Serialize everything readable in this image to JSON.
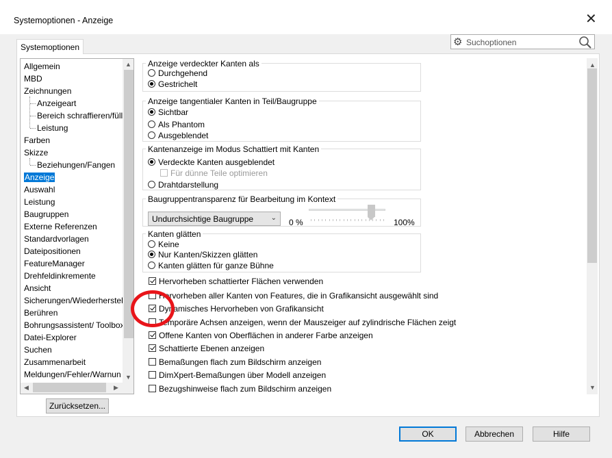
{
  "window": {
    "title": "Systemoptionen - Anzeige",
    "close_glyph": "✕",
    "close_icon": "close-icon"
  },
  "search": {
    "placeholder": "Suchoptionen",
    "gear_icon": "gear-icon",
    "search_icon": "search-icon"
  },
  "tab": {
    "label": "Systemoptionen"
  },
  "tree": {
    "items": [
      {
        "label": "Allgemein",
        "level": 1
      },
      {
        "label": "MBD",
        "level": 1
      },
      {
        "label": "Zeichnungen",
        "level": 1
      },
      {
        "label": "Anzeigeart",
        "level": 2
      },
      {
        "label": "Bereich schraffieren/füll",
        "level": 2
      },
      {
        "label": "Leistung",
        "level": 2
      },
      {
        "label": "Farben",
        "level": 1
      },
      {
        "label": "Skizze",
        "level": 1
      },
      {
        "label": "Beziehungen/Fangen",
        "level": 2
      },
      {
        "label": "Anzeige",
        "level": 1,
        "selected": true
      },
      {
        "label": "Auswahl",
        "level": 1
      },
      {
        "label": "Leistung",
        "level": 1
      },
      {
        "label": "Baugruppen",
        "level": 1
      },
      {
        "label": "Externe Referenzen",
        "level": 1
      },
      {
        "label": "Standardvorlagen",
        "level": 1
      },
      {
        "label": "Dateipositionen",
        "level": 1
      },
      {
        "label": "FeatureManager",
        "level": 1
      },
      {
        "label": "Drehfeldinkremente",
        "level": 1
      },
      {
        "label": "Ansicht",
        "level": 1
      },
      {
        "label": "Sicherungen/Wiederherstel",
        "level": 1
      },
      {
        "label": "Berühren",
        "level": 1
      },
      {
        "label": "Bohrungsassistent/ Toolbox",
        "level": 1
      },
      {
        "label": "Datei-Explorer",
        "level": 1
      },
      {
        "label": "Suchen",
        "level": 1
      },
      {
        "label": "Zusammenarbeit",
        "level": 1
      },
      {
        "label": "Meldungen/Fehler/Warnun",
        "level": 1
      }
    ]
  },
  "reset_button": "Zurücksetzen...",
  "groups": {
    "hidden_edges": {
      "title": "Anzeige verdeckter Kanten als",
      "options": [
        {
          "label": "Durchgehend",
          "checked": false
        },
        {
          "label": "Gestrichelt",
          "checked": true
        }
      ]
    },
    "tangent_edges": {
      "title": "Anzeige tangentialer Kanten in Teil/Baugruppe",
      "options": [
        {
          "label": "Sichtbar",
          "checked": true
        },
        {
          "label": "Als Phantom",
          "checked": false
        },
        {
          "label": "Ausgeblendet",
          "checked": false
        }
      ]
    },
    "shaded_edges": {
      "title": "Kantenanzeige im Modus Schattiert mit Kanten",
      "options": [
        {
          "label": "Verdeckte Kanten ausgeblendet",
          "checked": true
        },
        {
          "label": "Drahtdarstellung",
          "checked": false
        }
      ],
      "sub_checkbox": {
        "label": "Für dünne Teile optimieren",
        "checked": false,
        "disabled": true
      }
    },
    "transparency": {
      "title": "Baugruppentransparenz für Bearbeitung im Kontext",
      "dropdown_value": "Undurchsichtige Baugruppe",
      "slider_min_label": "0 %",
      "slider_max_label": "100%",
      "slider_value_fraction": 0.85
    },
    "smooth_edges": {
      "title": "Kanten glätten",
      "options": [
        {
          "label": "Keine",
          "checked": false
        },
        {
          "label": "Nur Kanten/Skizzen glätten",
          "checked": true
        },
        {
          "label": "Kanten glätten für ganze Bühne",
          "checked": false
        }
      ]
    }
  },
  "checkboxes": [
    {
      "label": "Hervorheben schattierter Flächen verwenden",
      "checked": true
    },
    {
      "label": "Hervorheben aller Kanten von Features, die in Grafikansicht ausgewählt sind",
      "checked": false
    },
    {
      "label": "Dynamisches Hervorheben von Grafikansicht",
      "checked": true
    },
    {
      "label": "Temporäre Achsen anzeigen, wenn der Mauszeiger auf zylindrische Flächen zeigt",
      "checked": false
    },
    {
      "label": "Offene Kanten von Oberflächen in anderer Farbe anzeigen",
      "checked": true
    },
    {
      "label": "Schattierte Ebenen anzeigen",
      "checked": true
    },
    {
      "label": "Bemaßungen flach zum Bildschirm anzeigen",
      "checked": false
    },
    {
      "label": "DimXpert-Bemaßungen über Modell anzeigen",
      "checked": false
    },
    {
      "label": "Bezugshinweise flach zum Bildschirm anzeigen",
      "checked": false
    }
  ],
  "buttons": {
    "ok": "OK",
    "cancel": "Abbrechen",
    "help": "Hilfe"
  },
  "colors": {
    "accent": "#0078d7",
    "annotation_circle": "#e8151a"
  }
}
